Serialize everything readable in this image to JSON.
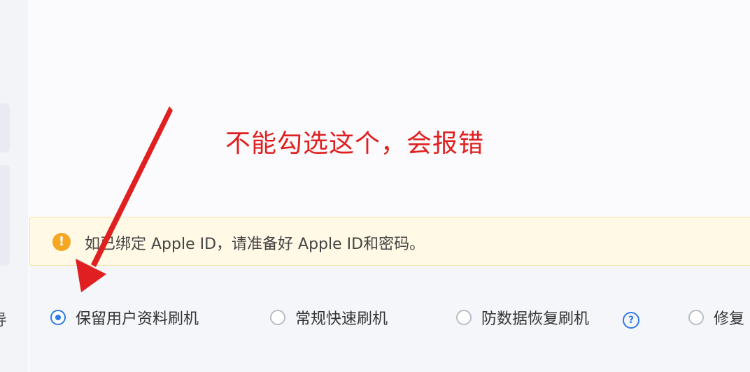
{
  "annotation": {
    "text": "不能勾选这个，会报错",
    "color": "#e02020"
  },
  "notice": {
    "icon": "warning-icon",
    "text": "如已绑定 Apple ID，请准备好 Apple ID和密码。"
  },
  "left_cut_text": "导",
  "flash_options": [
    {
      "label": "保留用户资料刷机",
      "selected": true
    },
    {
      "label": "常规快速刷机",
      "selected": false
    },
    {
      "label": "防数据恢复刷机",
      "selected": false
    },
    {
      "label": "修复",
      "selected": false
    }
  ],
  "help": {
    "icon": "help-icon",
    "symbol": "?"
  },
  "colors": {
    "accent": "#2f7be5",
    "warning": "#f5a623",
    "annotation_red": "#e02020"
  }
}
